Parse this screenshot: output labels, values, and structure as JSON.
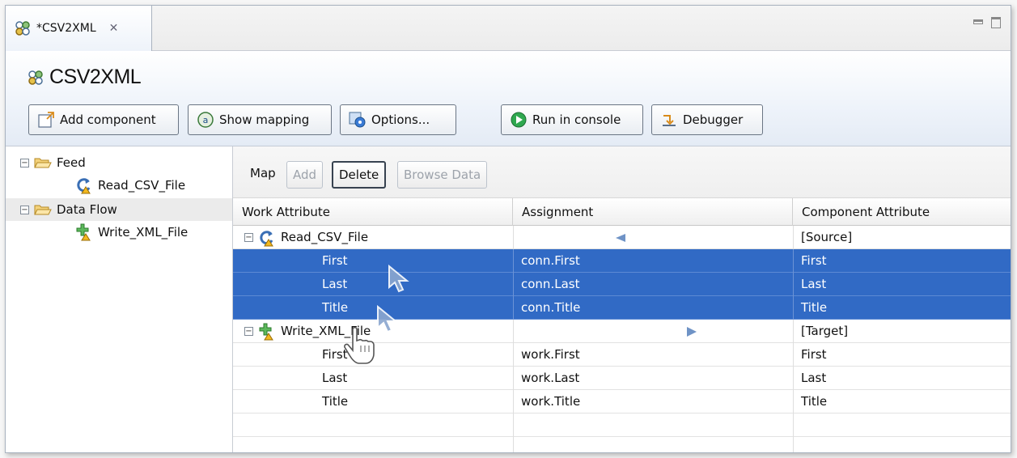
{
  "tab": {
    "label": "*CSV2XML",
    "close_glyph": "✕"
  },
  "editor": {
    "title": "CSV2XML"
  },
  "toolbar": {
    "add_component": "Add component",
    "show_mapping": "Show mapping",
    "options": "Options...",
    "run_in_console": "Run in console",
    "debugger": "Debugger"
  },
  "tree": {
    "nodes": [
      {
        "label": "Feed",
        "type": "folder",
        "expander": "⊟"
      },
      {
        "label": "Read_CSV_File",
        "type": "reader"
      },
      {
        "label": "Data Flow",
        "type": "folder",
        "expander": "⊟"
      },
      {
        "label": "Write_XML_File",
        "type": "writer"
      }
    ]
  },
  "mapbar": {
    "label": "Map",
    "add": "Add",
    "delete": "Delete",
    "browse_data": "Browse Data"
  },
  "table": {
    "headers": [
      "Work Attribute",
      "Assignment",
      "Component Attribute"
    ],
    "rows": [
      {
        "work": "Read_CSV_File",
        "assignment": "",
        "component": "[Source]",
        "kind": "group-source"
      },
      {
        "work": "First",
        "assignment": "conn.First",
        "component": "First",
        "selected": true
      },
      {
        "work": "Last",
        "assignment": "conn.Last",
        "component": "Last",
        "selected": true
      },
      {
        "work": "Title",
        "assignment": "conn.Title",
        "component": "Title",
        "selected": true
      },
      {
        "work": "Write_XML_File",
        "assignment": "",
        "component": "[Target]",
        "kind": "group-target"
      },
      {
        "work": "First",
        "assignment": "work.First",
        "component": "First"
      },
      {
        "work": "Last",
        "assignment": "work.Last",
        "component": "Last"
      },
      {
        "work": "Title",
        "assignment": "work.Title",
        "component": "Title"
      }
    ]
  },
  "colors": {
    "selection": "#316ac5",
    "accent": "#3a6fb5",
    "arrow": "#6f93c6"
  }
}
